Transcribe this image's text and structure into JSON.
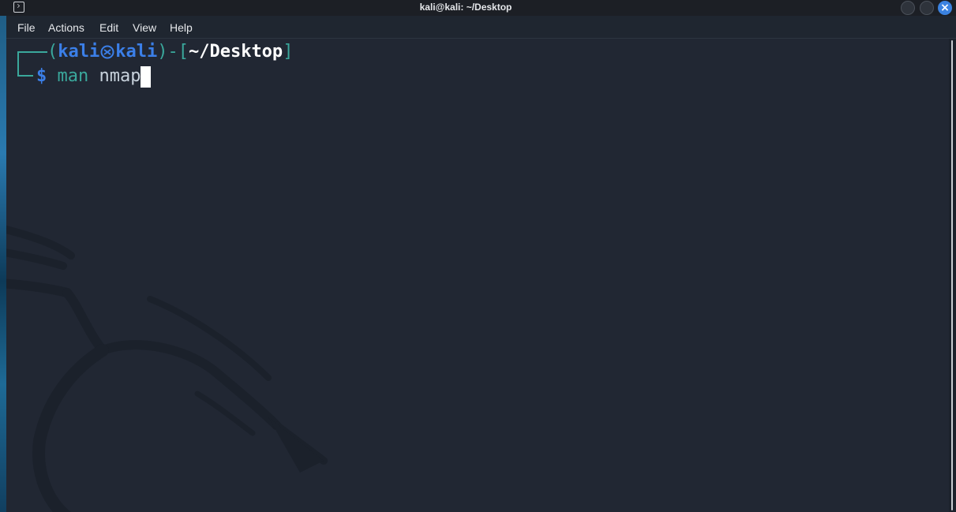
{
  "window": {
    "title": "kali@kali: ~/Desktop"
  },
  "menu": {
    "items": [
      "File",
      "Actions",
      "Edit",
      "View",
      "Help"
    ]
  },
  "prompt": {
    "open_paren": "(",
    "user": "kali",
    "separator_icon": "kali-skull-icon",
    "host": "kali",
    "close_paren_dash": ")-[",
    "cwd": "~/Desktop",
    "close_bracket": "]",
    "dollar": "$"
  },
  "command": {
    "program": "man",
    "argument": "nmap"
  },
  "colors": {
    "background": "#212733",
    "teal": "#3aa89c",
    "blue": "#3b7fe8",
    "close_button": "#3b82e0"
  },
  "icons": [
    "terminal-app-icon",
    "minimize-button",
    "maximize-button",
    "close-icon",
    "kali-dragon-watermark"
  ]
}
